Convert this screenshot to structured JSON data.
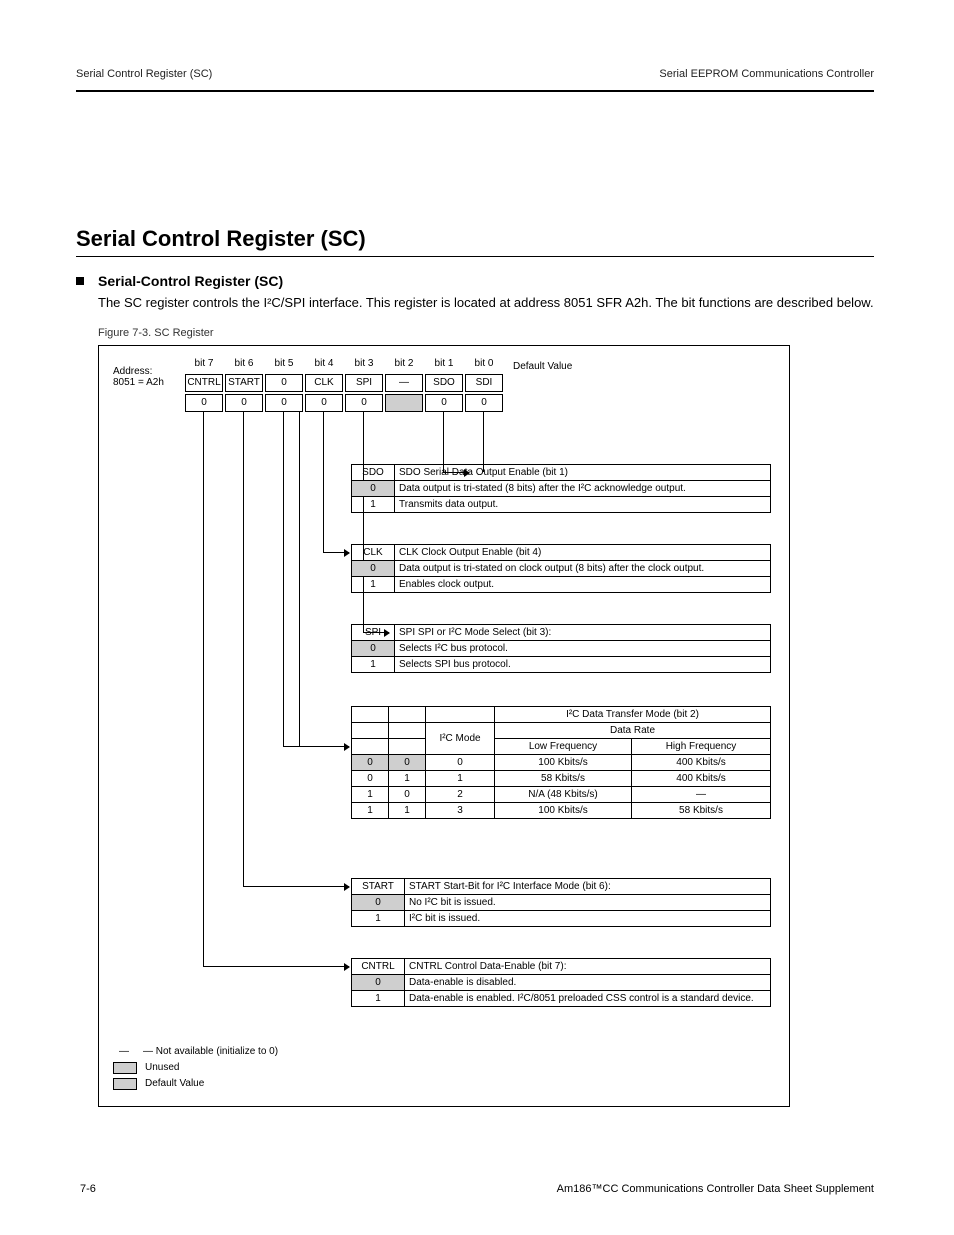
{
  "running_head_left": "Serial Control Register (SC)",
  "running_head_right": "Serial EEPROM Communications Controller",
  "section_title": "Serial Control Register (SC)",
  "bullet_title": "Serial-Control Register (SC)",
  "body_para": "The SC register controls the I²C/SPI interface. This register is located at address 8051 SFR A2h. The bit functions are described below.",
  "figcap": "Figure 7-3. SC Register",
  "addr": "Address:\n8051 = A2h",
  "bit_headers": [
    "bit 7",
    "bit 6",
    "bit 5",
    "bit 4",
    "bit 3",
    "bit 2",
    "bit 1",
    "bit 0"
  ],
  "bit_names": [
    "CNTRL",
    "START",
    "0",
    "CLK",
    "SPI",
    "—",
    "SDO",
    "SDI"
  ],
  "default_label": "Default Value",
  "defaults": [
    "0",
    "0",
    "0",
    "0",
    "0",
    "",
    "0",
    "0"
  ],
  "tableA": {
    "title": "SDO Serial Data Output Enable (bit 1)",
    "rows": [
      [
        "0",
        "Data output is tri-stated (8 bits) after the I²C acknowledge output."
      ],
      [
        "1",
        "Transmits data output."
      ]
    ]
  },
  "tableB": {
    "title": "CLK Clock Output Enable (bit 4)",
    "rows": [
      [
        "0",
        "Data output is tri-stated on clock output (8 bits) after the clock output."
      ],
      [
        "1",
        "Enables clock output."
      ]
    ]
  },
  "tableC": {
    "title": "SPI      SPI or I²C Mode Select (bit 3):",
    "rows": [
      [
        "0",
        "Selects I²C bus protocol."
      ],
      [
        "1",
        "Selects SPI bus protocol."
      ]
    ]
  },
  "tableD": {
    "head": [
      "",
      "",
      "",
      "I²C Data Transfer Mode (bit 2)"
    ],
    "sub": [
      "",
      "",
      "I²C Mode",
      "Data Rate"
    ],
    "sub2": [
      "",
      "",
      "",
      "Low Frequency",
      "High Frequency"
    ],
    "rows": [
      [
        "0",
        "0",
        "0",
        "100 Kbits/s",
        "400 Kbits/s"
      ],
      [
        "0",
        "1",
        "1",
        "58 Kbits/s",
        "400 Kbits/s"
      ],
      [
        "1",
        "0",
        "2",
        "N/A (48 Kbits/s)",
        "—"
      ],
      [
        "1",
        "1",
        "3",
        "100 Kbits/s",
        "58 Kbits/s"
      ]
    ]
  },
  "tableE": {
    "title": "START      Start-Bit for I²C Interface Mode (bit 6):",
    "rows": [
      [
        "0",
        "No I²C bit is issued."
      ],
      [
        "1",
        "I²C bit is issued."
      ]
    ]
  },
  "tableF": {
    "title": "CNTRL   Control Data-Enable (bit 7):",
    "rows": [
      [
        "0",
        "Data-enable is disabled."
      ],
      [
        "1",
        "Data-enable is enabled. I²C/8051 preloaded CSS control is a standard device."
      ]
    ]
  },
  "legend_dash": "—   Not available (initialize to 0)",
  "legend_unused": "Unused",
  "legend_default": "Default Value",
  "footer_left": "7-6",
  "footer_mid": "Am186™CC Communications Controller Data Sheet Supplement",
  "footer_right": ""
}
